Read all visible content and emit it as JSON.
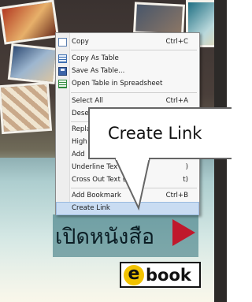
{
  "menu": {
    "items": [
      {
        "label": "Copy",
        "shortcut": "Ctrl+C",
        "icon": "copy-icon"
      },
      {
        "label": "Copy As Table",
        "shortcut": "",
        "icon": "table-icon"
      },
      {
        "label": "Save As Table...",
        "shortcut": "",
        "icon": "save-icon"
      },
      {
        "label": "Open Table in Spreadsheet",
        "shortcut": "",
        "icon": "spreadsheet-icon"
      },
      {
        "label": "Select All",
        "shortcut": "Ctrl+A"
      },
      {
        "label": "Desel",
        "shortcut": ""
      },
      {
        "label": "Repla",
        "shortcut": ""
      },
      {
        "label": "High",
        "shortcut": ""
      },
      {
        "label": "Add",
        "shortcut": ""
      },
      {
        "label": "Underline Tex",
        "shortcut": ")"
      },
      {
        "label": "Cross Out Text (C",
        "shortcut": "t)"
      },
      {
        "label": "Add Bookmark",
        "shortcut": "Ctrl+B"
      },
      {
        "label": "Create Link",
        "shortcut": ""
      }
    ],
    "highlighted_index": 12
  },
  "callout": {
    "text": "Create Link"
  },
  "background": {
    "banner_text": "เปิดหนังสือ",
    "logo_text": "ebook",
    "accent_color": "#c0182c",
    "highlight_color": "#c9dcf2"
  }
}
